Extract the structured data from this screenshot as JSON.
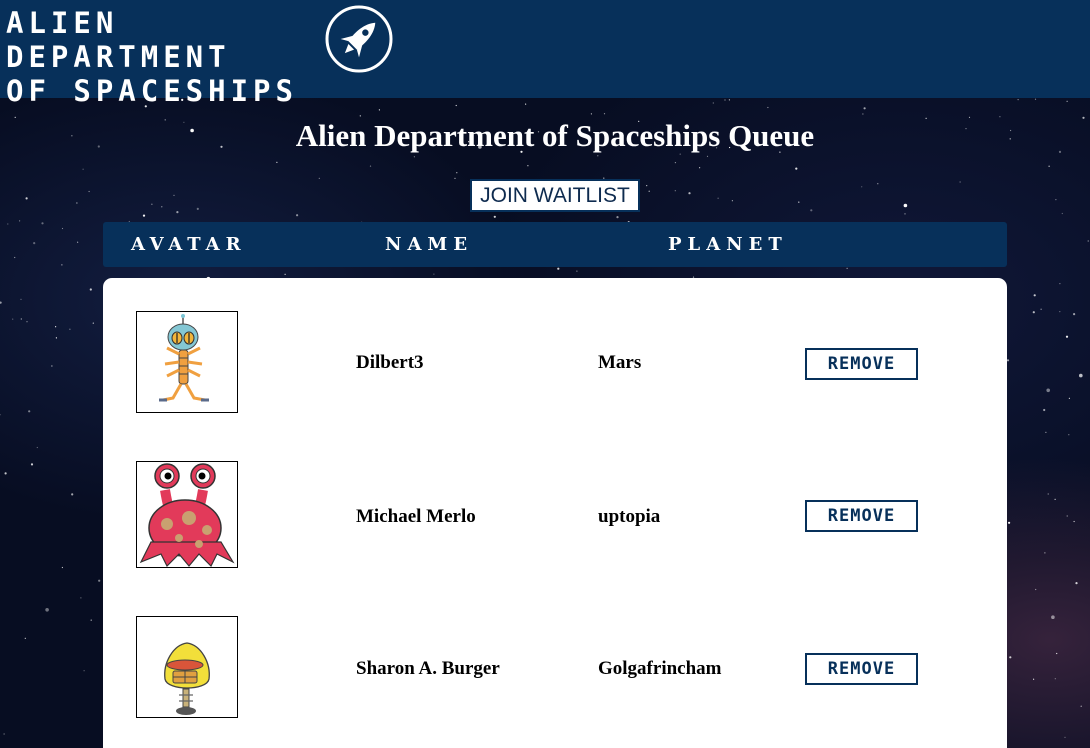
{
  "header": {
    "brand_line1": "ALIEN DEPARTMENT",
    "brand_line2": "OF SPACESHIPS",
    "logo_icon": "rocket-icon"
  },
  "main": {
    "title": "Alien Department of Spaceships Queue",
    "join_label": "JOIN WAITLIST"
  },
  "table": {
    "columns": [
      "AVATAR",
      "NAME",
      "PLANET"
    ],
    "rows": [
      {
        "avatar": "alien-dilbert3-avatar",
        "name": "Dilbert3",
        "planet": "Mars",
        "action": "REMOVE"
      },
      {
        "avatar": "alien-michael-merlo-avatar",
        "name": "Michael Merlo",
        "planet": "uptopia",
        "action": "REMOVE"
      },
      {
        "avatar": "alien-sharon-burger-avatar",
        "name": "Sharon A. Burger",
        "planet": "Golgafrincham",
        "action": "REMOVE"
      }
    ]
  },
  "colors": {
    "header_bg": "#07305a",
    "panel_bg": "#ffffff",
    "text_dark": "#000000"
  }
}
